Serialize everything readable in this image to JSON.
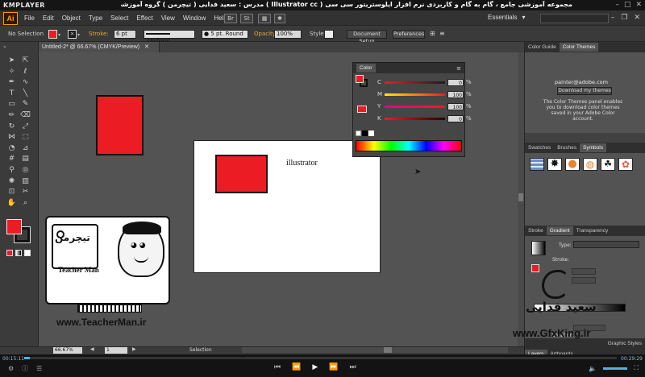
{
  "player": {
    "logo": "KMPLAYER",
    "video_title": "مجموعه آموزشی جامع ، گام به گام و کاربردی نرم افزار ایلوستریتور سی سی ( Illustrator cc ) مدرس : سعید فدایی ( تیچرمن ) گروه آموزشی پادشاه گرافیست ها",
    "time_current": "00:15:11",
    "time_total": "00:29:29",
    "progress": 0.01
  },
  "menubar": {
    "logo": "Ai",
    "items": [
      "File",
      "Edit",
      "Object",
      "Type",
      "Select",
      "Effect",
      "View",
      "Window",
      "Help"
    ],
    "bridge_label": "Br",
    "stock_label": "St",
    "workspace": "Essentials"
  },
  "controlbar": {
    "selection_label": "No Selection",
    "stroke_label": "Stroke:",
    "stroke_weight": "6 pt",
    "profile": "Uniform",
    "brush": "5 pt. Round",
    "opacity_label": "Opacity:",
    "opacity": "100%",
    "style_label": "Style:",
    "document_setup": "Document Setup",
    "preferences": "Preferences"
  },
  "document": {
    "tab_title": "Untitled-2* @ 66.67% (CMYK/Preview)",
    "artboard_text": "illustrator"
  },
  "color_panel": {
    "title": "Color",
    "sliders": [
      {
        "label": "C",
        "value": "0",
        "unit": "%"
      },
      {
        "label": "M",
        "value": "100",
        "unit": "%"
      },
      {
        "label": "Y",
        "value": "100",
        "unit": "%"
      },
      {
        "label": "K",
        "value": "0",
        "unit": "%"
      }
    ]
  },
  "right_panels": {
    "top_tabs": [
      "Color Guide",
      "Color Themes"
    ],
    "adobe_email": "painter@adobe.com",
    "download_button": "Download my themes",
    "themes_note": "The Color Themes panel enables you to download color themes saved in your Adobe Color account.",
    "mid_tabs": [
      "Swatches",
      "Brushes",
      "Symbols"
    ],
    "lower_tabs": [
      "Stroke",
      "Gradient",
      "Transparency"
    ],
    "type_label": "Type:",
    "stroke_label": "Stroke:",
    "location_label": "Location:",
    "graphic_styles_tab": "Graphic Styles",
    "bottom_tabs": [
      "Layers",
      "Artboards"
    ]
  },
  "statusbar": {
    "zoom": "66.67%",
    "page": "1",
    "mode": "Selection"
  },
  "watermark": {
    "brand_fa": "تیچرمن",
    "brand_en": "Teacher Man",
    "url_left": "www.TeacherMan.ir",
    "name_right_fa": "سعید فدایی",
    "url_right": "www.GfxKing.ir"
  },
  "colors": {
    "fill_red": "#ec1c24",
    "accent_orange": "#ff9a00",
    "canvas_gray": "#535353"
  }
}
